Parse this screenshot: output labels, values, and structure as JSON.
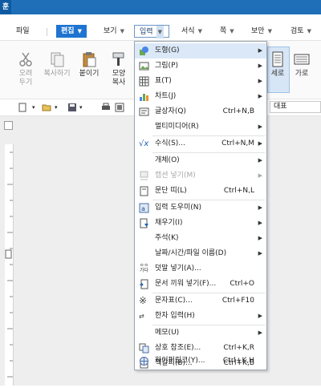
{
  "app": {
    "badge": "훈"
  },
  "menubar": {
    "file": "파일",
    "edit": "편집",
    "view": "보기",
    "input": "입력",
    "format": "서식",
    "page": "쪽",
    "security": "보안",
    "review": "검토"
  },
  "ribbon": {
    "cut": "오려\n두기",
    "copy": "복사하기",
    "paste": "붙이기",
    "format_copy": "모양\n복사",
    "portrait": "세로",
    "landscape": "가로"
  },
  "toolbar": {
    "style_value": "대표"
  },
  "dropdown": {
    "items": [
      {
        "label": "도형(G)",
        "shortcut": "",
        "submenu": true,
        "icon": "shapes-icon",
        "disabled": false
      },
      {
        "label": "그림(P)",
        "shortcut": "",
        "submenu": true,
        "icon": "picture-icon",
        "disabled": false
      },
      {
        "label": "표(T)",
        "shortcut": "",
        "submenu": true,
        "icon": "table-icon",
        "disabled": false
      },
      {
        "label": "차트(J)",
        "shortcut": "",
        "submenu": true,
        "icon": "chart-icon",
        "disabled": false
      },
      {
        "label": "글상자(Q)",
        "shortcut": "Ctrl+N,B",
        "submenu": false,
        "icon": "textbox-icon",
        "disabled": false
      },
      {
        "label": "멀티미디어(R)",
        "shortcut": "",
        "submenu": true,
        "icon": "",
        "disabled": false
      },
      {
        "label": "수식(S)...",
        "shortcut": "Ctrl+N,M",
        "submenu": true,
        "icon": "formula-icon",
        "disabled": false
      },
      {
        "label": "개체(O)",
        "shortcut": "",
        "submenu": true,
        "icon": "",
        "disabled": false
      },
      {
        "label": "캡션 넣기(M)",
        "shortcut": "",
        "submenu": true,
        "icon": "caption-icon",
        "disabled": true
      },
      {
        "label": "문단 띠(L)",
        "shortcut": "Ctrl+N,L",
        "submenu": false,
        "icon": "paragraph-band-icon",
        "disabled": false
      },
      {
        "label": "입력 도우미(N)",
        "shortcut": "",
        "submenu": true,
        "icon": "input-helper-icon",
        "disabled": false
      },
      {
        "label": "채우기(I)",
        "shortcut": "",
        "submenu": true,
        "icon": "fill-icon",
        "disabled": false
      },
      {
        "label": "주석(K)",
        "shortcut": "",
        "submenu": true,
        "icon": "",
        "disabled": false
      },
      {
        "label": "날짜/시간/파일 이름(D)",
        "shortcut": "",
        "submenu": true,
        "icon": "",
        "disabled": false
      },
      {
        "label": "덧말 넣기(A)...",
        "shortcut": "",
        "submenu": false,
        "icon": "ruby-text-icon",
        "disabled": false
      },
      {
        "label": "문서 끼워 넣기(F)...",
        "shortcut": "Ctrl+O",
        "submenu": false,
        "icon": "insert-document-icon",
        "disabled": false
      },
      {
        "label": "문자표(C)...",
        "shortcut": "Ctrl+F10",
        "submenu": false,
        "icon": "symbol-icon",
        "disabled": false
      },
      {
        "label": "한자 입력(H)",
        "shortcut": "",
        "submenu": true,
        "icon": "hanja-icon",
        "disabled": false
      },
      {
        "label": "메모(U)",
        "shortcut": "",
        "submenu": true,
        "icon": "",
        "disabled": false
      },
      {
        "label": "상호 참조(E)...",
        "shortcut": "Ctrl+K,R",
        "submenu": false,
        "icon": "cross-reference-icon",
        "disabled": false
      },
      {
        "label": "책갈피(B)...",
        "shortcut": "Ctrl+K,B",
        "submenu": false,
        "icon": "bookmark-icon",
        "disabled": false
      },
      {
        "label": "하이퍼링크(Y)...",
        "shortcut": "Ctrl+K,H",
        "submenu": false,
        "icon": "hyperlink-icon",
        "disabled": false
      }
    ]
  }
}
